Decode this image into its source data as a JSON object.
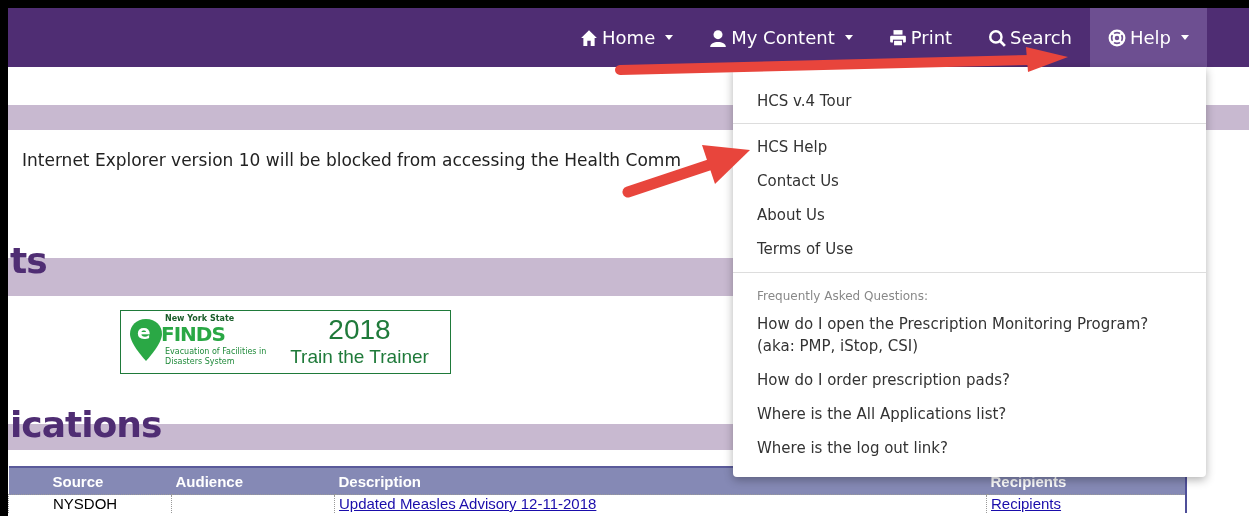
{
  "navbar": {
    "items": [
      {
        "label": "Home",
        "dropdown": true,
        "selected": false
      },
      {
        "label": "My Content",
        "dropdown": true,
        "selected": false
      },
      {
        "label": "Print",
        "dropdown": false,
        "selected": false
      },
      {
        "label": "Search",
        "dropdown": false,
        "selected": false
      },
      {
        "label": "Help",
        "dropdown": true,
        "selected": true
      }
    ]
  },
  "notice": "Internet Explorer version 10 will be blocked from accessing the Health Comm",
  "sections": [
    {
      "heading": "ts"
    },
    {
      "heading": "ications"
    }
  ],
  "banner": {
    "top_text": "New York State",
    "logo_text": "FINDS",
    "logo_letter": "e",
    "sub_text": "Evacuation of Facilities in Disasters System",
    "year": "2018",
    "title": "Train the Trainer"
  },
  "table": {
    "columns": [
      "Source",
      "Audience",
      "Description",
      "Recipients"
    ],
    "rows": [
      {
        "source": "NYSDOH",
        "description": "Updated Measles Advisory 12-11-2018",
        "recipients": "Recipients"
      }
    ]
  },
  "help_menu": {
    "groups": [
      {
        "items": [
          "HCS v.4 Tour"
        ]
      },
      {
        "items": [
          "HCS Help",
          "Contact Us",
          "About Us",
          "Terms of Use"
        ]
      },
      {
        "header": "Frequently Asked Questions:",
        "items": [
          "How do I open the Prescription Monitoring Program? (aka: PMP, iStop, CSI)",
          "How do I order prescription pads?",
          "Where is the All Applications list?",
          "Where is the log out link?"
        ]
      }
    ]
  }
}
